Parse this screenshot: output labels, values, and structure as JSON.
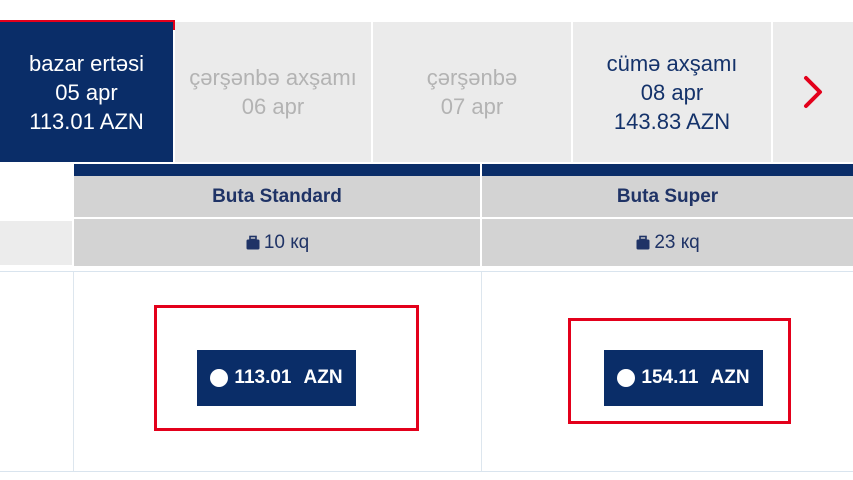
{
  "date_tabs": [
    {
      "weekday": "bazar ertəsi",
      "date": "05 apr",
      "price": "113.01 AZN"
    },
    {
      "weekday": "çərşənbə axşamı",
      "date": "06 apr"
    },
    {
      "weekday": "çərşənbə",
      "date": "07 apr"
    },
    {
      "weekday": "cümə axşamı",
      "date": "08 apr",
      "price": "143.83 AZN"
    }
  ],
  "next_icon": "chevron-right-icon",
  "fares": [
    {
      "name": "Buta Standard",
      "baggage": "10 кq",
      "baggage_icon": "luggage-icon",
      "amount": "113.01",
      "currency": "AZN"
    },
    {
      "name": "Buta Super",
      "baggage": "23 кq",
      "baggage_icon": "luggage-icon",
      "amount": "154.11",
      "currency": "AZN"
    }
  ],
  "colors": {
    "brand_navy": "#0a2d68",
    "accent_red": "#e3001b",
    "tab_grey": "#ebebeb",
    "header_grey": "#d3d3d3"
  }
}
